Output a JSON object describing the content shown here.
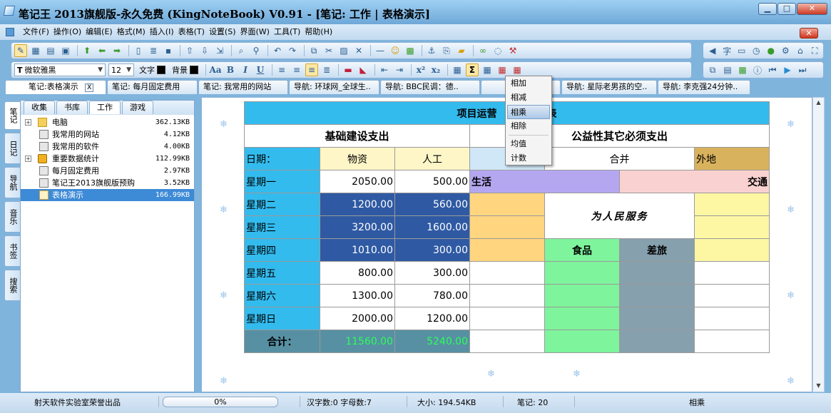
{
  "window": {
    "title": "笔记王 2013旗舰版-永久免费 (KingNoteBook) V0.91 - [笔记: 工作 | 表格演示]",
    "controls": {
      "minimize": "▁",
      "maximize": "□",
      "close": "✕"
    }
  },
  "menu": {
    "items": [
      "文件(F)",
      "操作(O)",
      "编辑(E)",
      "格式(M)",
      "插入(I)",
      "表格(T)",
      "设置(S)",
      "界面(W)",
      "工具(T)",
      "帮助(H)"
    ],
    "close": "✕"
  },
  "format_toolbar": {
    "font_name": "微软雅黑",
    "font_size": "12",
    "text_color_label": "文字",
    "bg_color_label": "背景",
    "text_color": "#000000",
    "bg_color": "#000000",
    "aa": "Aa",
    "bold": "B",
    "italic": "I",
    "underline": "U"
  },
  "doc_tabs": [
    {
      "label": "笔记:表格演示",
      "active": true
    },
    {
      "label": "笔记: 每月固定费用"
    },
    {
      "label": "笔记: 我常用的网站"
    },
    {
      "label": "导航: 环球网_全球生.."
    },
    {
      "label": "导航: BBC民调：德.."
    },
    {
      "label": "导航: 星际老男孩的空.."
    },
    {
      "label": "导航: 李克强24分钟.."
    }
  ],
  "side_tabs": [
    "笔记",
    "日记",
    "导航",
    "音乐",
    "书签",
    "搜索"
  ],
  "left_panel": {
    "tabs": [
      "收集",
      "书库",
      "工作",
      "游戏"
    ],
    "tree": [
      {
        "label": "电脑",
        "size": "362.13KB",
        "icon": "folder-icon",
        "expand": "+"
      },
      {
        "label": "我常用的网站",
        "size": "4.12KB",
        "icon": "doc-icon"
      },
      {
        "label": "我常用的软件",
        "size": "4.00KB",
        "icon": "doc-icon"
      },
      {
        "label": "重要数据统计",
        "size": "112.99KB",
        "icon": "lock-icon",
        "expand": "+"
      },
      {
        "label": "每月固定费用",
        "size": "2.97KB",
        "icon": "doc-icon"
      },
      {
        "label": "笔记王2013旗舰版预购",
        "size": "3.52KB",
        "icon": "doc-icon"
      },
      {
        "label": "表格演示",
        "size": "166.99KB",
        "icon": "edit-icon",
        "selected": true
      }
    ]
  },
  "sheet": {
    "title": "项目运营",
    "title_suffix": "算表",
    "group_left": "基础建设支出",
    "group_right": "公益性其它必须支出",
    "date_label": "日期：",
    "col_goods": "物资",
    "col_labor": "人工",
    "col_merge": "合并",
    "col_other": "外地",
    "cat_life": "生活",
    "cat_transport": "交通",
    "cat_food": "食品",
    "cat_travel": "差旅",
    "calligraphy": "为人民服务",
    "rows": [
      {
        "day": "星期一",
        "goods": "2050.00",
        "labor": "500.00"
      },
      {
        "day": "星期二",
        "goods": "1200.00",
        "labor": "560.00"
      },
      {
        "day": "星期三",
        "goods": "3200.00",
        "labor": "1600.00"
      },
      {
        "day": "星期四",
        "goods": "1010.00",
        "labor": "300.00"
      },
      {
        "day": "星期五",
        "goods": "800.00",
        "labor": "300.00"
      },
      {
        "day": "星期六",
        "goods": "1300.00",
        "labor": "780.00"
      },
      {
        "day": "星期日",
        "goods": "2000.00",
        "labor": "1200.00"
      }
    ],
    "total_label": "合计：",
    "total_goods": "11560.00",
    "total_labor": "5240.00"
  },
  "popup_menu": {
    "items": [
      "相加",
      "相减",
      "相乘",
      "相除",
      "均值",
      "计数"
    ],
    "highlighted": "相乘"
  },
  "status": {
    "credit": "射天软件实验室荣誉出品",
    "progress": "0%",
    "progress_value": 0,
    "char_count": "汉字数:0  字母数:7",
    "size": "大小: 194.54KB",
    "notes": "笔记: 20",
    "action": "相乘"
  },
  "colors": {
    "accent": "#33bbee",
    "navy": "#2f5aa3",
    "selection": "#3d8ad6"
  }
}
